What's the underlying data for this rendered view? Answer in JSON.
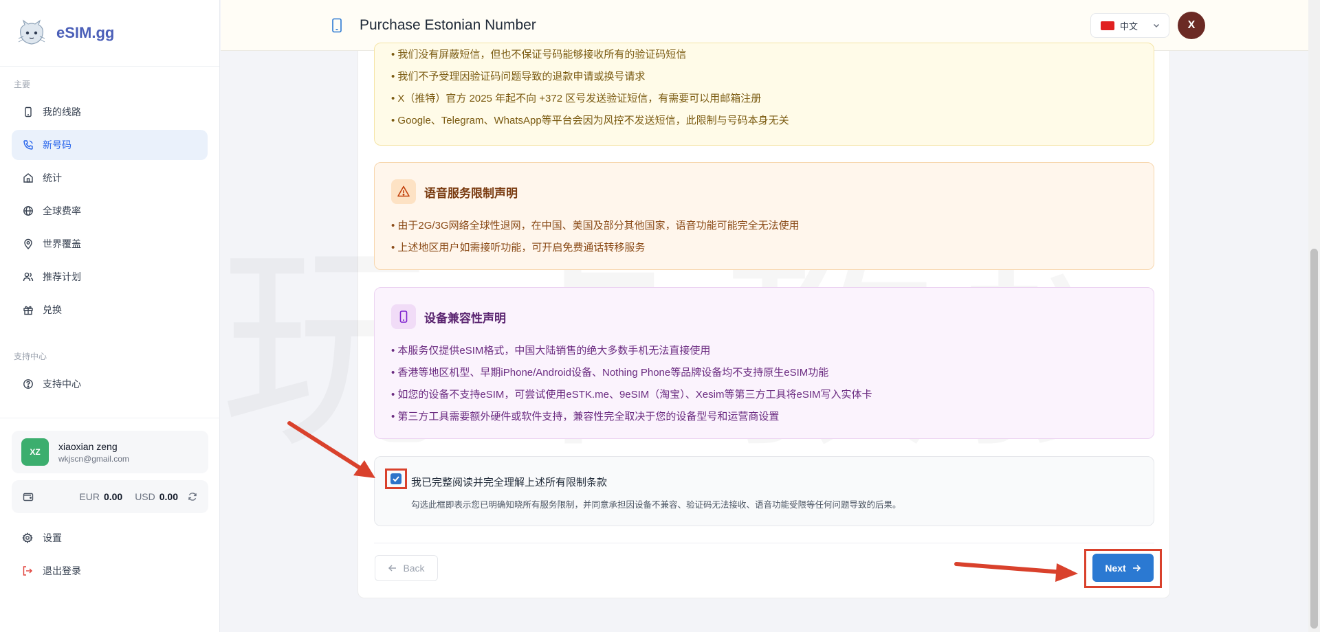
{
  "brand": {
    "name": "eSIM.gg"
  },
  "sidebar": {
    "section_main": "主要",
    "items": [
      {
        "label": "我的线路",
        "icon": "phone-icon"
      },
      {
        "label": "新号码",
        "icon": "phone-call-icon"
      },
      {
        "label": "统计",
        "icon": "home-icon"
      },
      {
        "label": "全球费率",
        "icon": "globe-icon"
      },
      {
        "label": "世界覆盖",
        "icon": "map-pin-icon"
      },
      {
        "label": "推荐计划",
        "icon": "users-icon"
      },
      {
        "label": "兑换",
        "icon": "gift-icon"
      }
    ],
    "active_index": 1,
    "section_support": "支持中心",
    "support_items": [
      {
        "label": "支持中心",
        "icon": "help-circle-icon"
      }
    ],
    "user": {
      "initials": "XZ",
      "name": "xiaoxian zeng",
      "email": "wkjscn@gmail.com"
    },
    "balance": {
      "eur_label": "EUR",
      "eur_value": "0.00",
      "usd_label": "USD",
      "usd_value": "0.00"
    },
    "bottom": [
      {
        "label": "设置",
        "icon": "gear-icon"
      },
      {
        "label": "退出登录",
        "icon": "logout-icon"
      }
    ]
  },
  "header": {
    "title": "Purchase Estonian Number",
    "language": "中文",
    "avatar_initial": "X"
  },
  "sms_notice": {
    "bullets": [
      "• 我们没有屏蔽短信，但也不保证号码能够接收所有的验证码短信",
      "• 我们不予受理因验证码问题导致的退款申请或换号请求",
      "• X（推特）官方 2025 年起不向 +372 区号发送验证短信，有需要可以用邮箱注册",
      "• Google、Telegram、WhatsApp等平台会因为风控不发送短信，此限制与号码本身无关"
    ]
  },
  "voice_notice": {
    "title": "语音服务限制声明",
    "bullets": [
      "• 由于2G/3G网络全球性退网，在中国、美国及部分其他国家，语音功能可能完全无法使用",
      "• 上述地区用户如需接听功能，可开启免费通话转移服务"
    ]
  },
  "device_notice": {
    "title": "设备兼容性声明",
    "bullets": [
      "• 本服务仅提供eSIM格式，中国大陆销售的绝大多数手机无法直接使用",
      "• 香港等地区机型、早期iPhone/Android设备、Nothing Phone等品牌设备均不支持原生eSIM功能",
      "• 如您的设备不支持eSIM，可尝试使用eSTK.me、9eSIM（淘宝）、Xesim等第三方工具将eSIM写入实体卡",
      "• 第三方工具需要额外硬件或软件支持，兼容性完全取决于您的设备型号和运营商设置"
    ]
  },
  "consent": {
    "checked": true,
    "label": "我已完整阅读并完全理解上述所有限制条款",
    "description": "勾选此框即表示您已明确知晓所有服务限制，并同意承担因设备不兼容、验证码无法接收、语音功能受限等任何问题导致的后果。"
  },
  "actions": {
    "back": "Back",
    "next": "Next"
  },
  "watermark": "玩卡教授",
  "colors": {
    "accent": "#2b79d2",
    "annotation": "#d9412c",
    "active_nav_bg": "#eaf1fb",
    "user_avatar": "#3cae6e",
    "header_avatar": "#6b2a24"
  }
}
